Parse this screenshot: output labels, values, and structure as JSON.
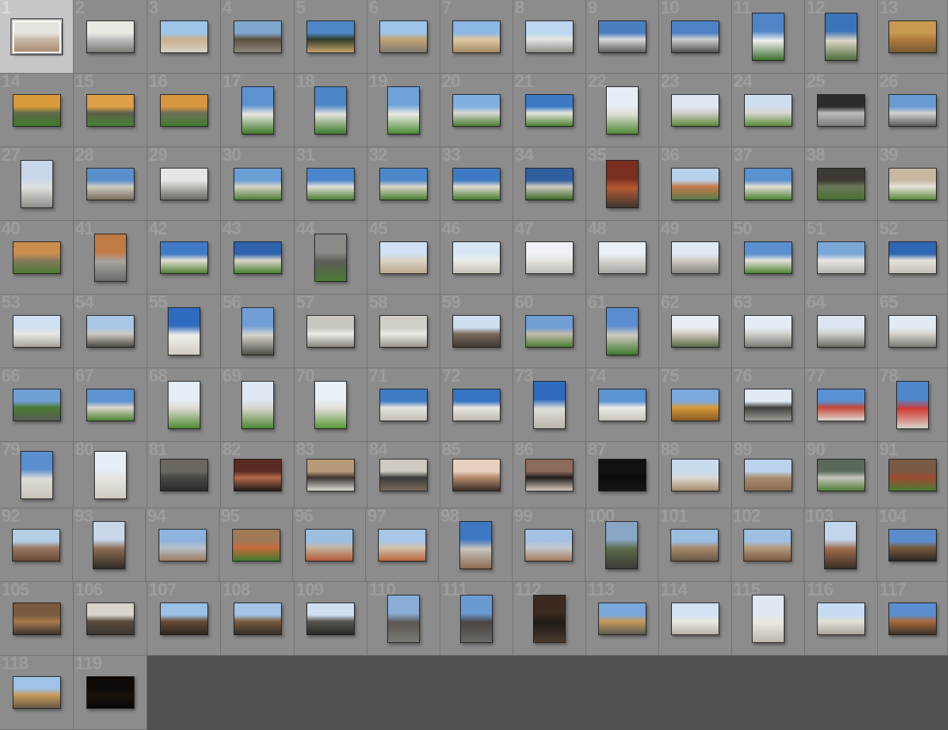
{
  "grid": {
    "columns": 13,
    "selected": 1,
    "tiles": [
      {
        "n": "1",
        "o": "land",
        "c": [
          "#e8e4df",
          "#c9b9a6",
          "#a98d75"
        ]
      },
      {
        "n": "2",
        "o": "land",
        "c": [
          "#eae9e4",
          "#bfbfbf",
          "#7a7a76"
        ]
      },
      {
        "n": "3",
        "o": "land",
        "c": [
          "#9ec4e8",
          "#c9b08a",
          "#d8d2c8"
        ]
      },
      {
        "n": "4",
        "o": "land",
        "c": [
          "#7fa8cf",
          "#5b4f3c",
          "#8e8a80"
        ]
      },
      {
        "n": "5",
        "o": "land",
        "c": [
          "#4f86c6",
          "#2f3d2a",
          "#c9a46a"
        ]
      },
      {
        "n": "6",
        "o": "land",
        "c": [
          "#9ec6ea",
          "#c4a271",
          "#7f7a72"
        ]
      },
      {
        "n": "7",
        "o": "land",
        "c": [
          "#8cb8e5",
          "#e2c9a0",
          "#a28a66"
        ]
      },
      {
        "n": "8",
        "o": "land",
        "c": [
          "#bcd7ef",
          "#e7e5e1",
          "#8f8e8a"
        ]
      },
      {
        "n": "9",
        "o": "land",
        "c": [
          "#4b7fbf",
          "#dcdcdc",
          "#5b5b58"
        ]
      },
      {
        "n": "10",
        "o": "land",
        "c": [
          "#4d82c4",
          "#d0d0cf",
          "#4f4f4d"
        ]
      },
      {
        "n": "11",
        "o": "port",
        "c": [
          "#4f86c7",
          "#eeeeee",
          "#3e6f2e"
        ]
      },
      {
        "n": "12",
        "o": "port",
        "c": [
          "#3d73b8",
          "#ddd7c8",
          "#4d6b3a"
        ]
      },
      {
        "n": "13",
        "o": "land",
        "c": [
          "#c89a52",
          "#b07a3c",
          "#7a5a34"
        ]
      },
      {
        "n": "14",
        "o": "land",
        "c": [
          "#d99b3a",
          "#5f6a4a",
          "#3f7a2a"
        ]
      },
      {
        "n": "15",
        "o": "land",
        "c": [
          "#e0a048",
          "#5a5f48",
          "#468034"
        ]
      },
      {
        "n": "16",
        "o": "land",
        "c": [
          "#d6973e",
          "#6f6f5a",
          "#3f7d2c"
        ]
      },
      {
        "n": "17",
        "o": "port",
        "c": [
          "#5c92cf",
          "#e8e6e1",
          "#3f7a2a"
        ]
      },
      {
        "n": "18",
        "o": "port",
        "c": [
          "#4b85c8",
          "#e4e2dc",
          "#3d7a2b"
        ]
      },
      {
        "n": "19",
        "o": "port",
        "c": [
          "#6ea2d8",
          "#eceae4",
          "#4a8a32"
        ]
      },
      {
        "n": "20",
        "o": "land",
        "c": [
          "#7fb0e0",
          "#d8d8d4",
          "#4b7f33"
        ]
      },
      {
        "n": "21",
        "o": "land",
        "c": [
          "#3e7ac4",
          "#e6e4de",
          "#4c8233"
        ]
      },
      {
        "n": "22",
        "o": "port",
        "c": [
          "#e8eef6",
          "#e0ddd5",
          "#4e8a34"
        ]
      },
      {
        "n": "23",
        "o": "land",
        "c": [
          "#dfe8f2",
          "#cfcdc8",
          "#5a8a3a"
        ]
      },
      {
        "n": "24",
        "o": "land",
        "c": [
          "#cfdff0",
          "#d8d6d0",
          "#5b8c3c"
        ]
      },
      {
        "n": "25",
        "o": "land",
        "c": [
          "#2c2c2c",
          "#bcbcb8",
          "#7c7c78"
        ]
      },
      {
        "n": "26",
        "o": "land",
        "c": [
          "#6a9bd3",
          "#d2d2cf",
          "#5c5c59"
        ]
      },
      {
        "n": "27",
        "o": "port",
        "c": [
          "#c8d8ea",
          "#dfdfdc",
          "#8c8c88"
        ]
      },
      {
        "n": "28",
        "o": "land",
        "c": [
          "#5a8fcc",
          "#cfccc4",
          "#7a6e5c"
        ]
      },
      {
        "n": "29",
        "o": "land",
        "c": [
          "#e6e6e4",
          "#bdbdb8",
          "#6c6c66"
        ]
      },
      {
        "n": "30",
        "o": "land",
        "c": [
          "#6c9fd6",
          "#d8d4c8",
          "#4f7f37"
        ]
      },
      {
        "n": "31",
        "o": "land",
        "c": [
          "#4a86cb",
          "#e2e0da",
          "#4c7f33"
        ]
      },
      {
        "n": "32",
        "o": "land",
        "c": [
          "#4e88cc",
          "#dcd7cb",
          "#4a7d30"
        ]
      },
      {
        "n": "33",
        "o": "land",
        "c": [
          "#3f7bc4",
          "#e0dbd0",
          "#497c31"
        ]
      },
      {
        "n": "34",
        "o": "land",
        "c": [
          "#2f5f9f",
          "#cfcac0",
          "#3c6a28"
        ]
      },
      {
        "n": "35",
        "o": "port",
        "c": [
          "#7a2f1e",
          "#b55a32",
          "#3d3530"
        ]
      },
      {
        "n": "36",
        "o": "land",
        "c": [
          "#b8d2ec",
          "#c77a4a",
          "#5a7a4a"
        ]
      },
      {
        "n": "37",
        "o": "land",
        "c": [
          "#5a91d0",
          "#e2ddd1",
          "#4d8236"
        ]
      },
      {
        "n": "38",
        "o": "land",
        "c": [
          "#3d3a33",
          "#6a7a5a",
          "#4a6f32"
        ]
      },
      {
        "n": "39",
        "o": "land",
        "c": [
          "#c8b8a2",
          "#e6e2da",
          "#5a8a3a"
        ]
      },
      {
        "n": "40",
        "o": "land",
        "c": [
          "#c98e4c",
          "#8a7a5e",
          "#4a7a30"
        ]
      },
      {
        "n": "41",
        "o": "port",
        "c": [
          "#c07a44",
          "#a8a4a0",
          "#6a6a66"
        ]
      },
      {
        "n": "42",
        "o": "land",
        "c": [
          "#3f7ac6",
          "#e4dfd4",
          "#4d8034"
        ]
      },
      {
        "n": "43",
        "o": "land",
        "c": [
          "#2f63ad",
          "#dcd6ca",
          "#497e32"
        ]
      },
      {
        "n": "44",
        "o": "port",
        "c": [
          "#8a8a86",
          "#5c5c58",
          "#4a7a33"
        ]
      },
      {
        "n": "45",
        "o": "land",
        "c": [
          "#cfe1f2",
          "#dcd4c4",
          "#b8a98e"
        ]
      },
      {
        "n": "46",
        "o": "land",
        "c": [
          "#d7e6f4",
          "#eeeeea",
          "#c7c2b8"
        ]
      },
      {
        "n": "47",
        "o": "land",
        "c": [
          "#eef2f6",
          "#e6e4e0",
          "#bdbbb6"
        ]
      },
      {
        "n": "48",
        "o": "land",
        "c": [
          "#eaf0f6",
          "#d8d6d2",
          "#a8a6a2"
        ]
      },
      {
        "n": "49",
        "o": "land",
        "c": [
          "#dfe9f4",
          "#cfcbc3",
          "#8a8782"
        ]
      },
      {
        "n": "50",
        "o": "land",
        "c": [
          "#5a90cf",
          "#e6e2da",
          "#4f8236"
        ]
      },
      {
        "n": "51",
        "o": "land",
        "c": [
          "#7aa7d8",
          "#e8e6e2",
          "#b5b2ac"
        ]
      },
      {
        "n": "52",
        "o": "land",
        "c": [
          "#2f67b4",
          "#e6e3dd",
          "#c2beb6"
        ]
      },
      {
        "n": "53",
        "o": "land",
        "c": [
          "#cfe0f2",
          "#e8e6e0",
          "#a8a49c"
        ]
      },
      {
        "n": "54",
        "o": "land",
        "c": [
          "#a8c6e6",
          "#cfcbc3",
          "#4b4944"
        ]
      },
      {
        "n": "55",
        "o": "port",
        "c": [
          "#2f6bbf",
          "#f0efec",
          "#d0ccc4"
        ]
      },
      {
        "n": "56",
        "o": "port",
        "c": [
          "#6f9fd6",
          "#d8d4cc",
          "#4f4d48"
        ]
      },
      {
        "n": "57",
        "o": "land",
        "c": [
          "#c9c6bf",
          "#eeece8",
          "#8a8782"
        ]
      },
      {
        "n": "58",
        "o": "land",
        "c": [
          "#d2cfc8",
          "#ebe9e4",
          "#9a968e"
        ]
      },
      {
        "n": "59",
        "o": "land",
        "c": [
          "#cfe0f2",
          "#7a6a5c",
          "#3f3a34"
        ]
      },
      {
        "n": "60",
        "o": "land",
        "c": [
          "#6f9fd4",
          "#c4bcae",
          "#4b7d32"
        ]
      },
      {
        "n": "61",
        "o": "port",
        "c": [
          "#5a8ed0",
          "#cfcac0",
          "#3e7a2c"
        ]
      },
      {
        "n": "62",
        "o": "land",
        "c": [
          "#e8eef4",
          "#cfc9bd",
          "#5a6a44"
        ]
      },
      {
        "n": "63",
        "o": "land",
        "c": [
          "#e6edf4",
          "#d0d0cc",
          "#7a7a76"
        ]
      },
      {
        "n": "64",
        "o": "land",
        "c": [
          "#dbe6f2",
          "#cfccc6",
          "#6c6c68"
        ]
      },
      {
        "n": "65",
        "o": "land",
        "c": [
          "#e2ebf4",
          "#d6d3cc",
          "#7c7a76"
        ]
      },
      {
        "n": "66",
        "o": "land",
        "c": [
          "#6fa0d6",
          "#4a7a32",
          "#5a5a56"
        ]
      },
      {
        "n": "67",
        "o": "land",
        "c": [
          "#5c92d0",
          "#dcd6ca",
          "#4d8234"
        ]
      },
      {
        "n": "68",
        "o": "port",
        "c": [
          "#e6eef6",
          "#dcd8cf",
          "#4f8a33"
        ]
      },
      {
        "n": "69",
        "o": "port",
        "c": [
          "#dde8f3",
          "#d6d2c9",
          "#4e8834"
        ]
      },
      {
        "n": "70",
        "o": "port",
        "c": [
          "#e9f0f6",
          "#e2ded6",
          "#5a9638"
        ]
      },
      {
        "n": "71",
        "o": "land",
        "c": [
          "#3f7cc6",
          "#e6e4de",
          "#c2beb6"
        ]
      },
      {
        "n": "72",
        "o": "land",
        "c": [
          "#3575c4",
          "#e8e6e0",
          "#bdb9b1"
        ]
      },
      {
        "n": "73",
        "o": "port",
        "c": [
          "#2f6cbd",
          "#e2e0da",
          "#b8b4ac"
        ]
      },
      {
        "n": "74",
        "o": "land",
        "c": [
          "#5a92d2",
          "#ecebe7",
          "#c8c4bc"
        ]
      },
      {
        "n": "75",
        "o": "land",
        "c": [
          "#7aaade",
          "#d69a3a",
          "#8a5a24"
        ]
      },
      {
        "n": "76",
        "o": "land",
        "c": [
          "#e2eaf4",
          "#3f3f3c",
          "#9a9a96"
        ]
      },
      {
        "n": "77",
        "o": "land",
        "c": [
          "#5a91d2",
          "#c8463a",
          "#dcd8d0"
        ]
      },
      {
        "n": "78",
        "o": "port",
        "c": [
          "#4d87cb",
          "#d43a32",
          "#d8d4cc"
        ]
      },
      {
        "n": "79",
        "o": "port",
        "c": [
          "#5a90d0",
          "#dedcd6",
          "#c8c4ba"
        ]
      },
      {
        "n": "80",
        "o": "port",
        "c": [
          "#e6eef6",
          "#e6e4de",
          "#cfcbc3"
        ]
      },
      {
        "n": "81",
        "o": "land",
        "c": [
          "#6a6660",
          "#4a4743",
          "#2c2a28"
        ]
      },
      {
        "n": "82",
        "o": "land",
        "c": [
          "#5a2a22",
          "#b56a4c",
          "#1e1a18"
        ]
      },
      {
        "n": "83",
        "o": "land",
        "c": [
          "#b89a7a",
          "#3a3430",
          "#dedcd8"
        ]
      },
      {
        "n": "84",
        "o": "land",
        "c": [
          "#cfcac2",
          "#3a3a3a",
          "#7a6a5c"
        ]
      },
      {
        "n": "85",
        "o": "land",
        "c": [
          "#e8d0c0",
          "#b58a6c",
          "#3a2e28"
        ]
      },
      {
        "n": "86",
        "o": "land",
        "c": [
          "#8a6a5a",
          "#1e1c1a",
          "#d8cabc"
        ]
      },
      {
        "n": "87",
        "o": "land",
        "c": [
          "#111111",
          "#0b0b0b",
          "#151515"
        ]
      },
      {
        "n": "88",
        "o": "land",
        "c": [
          "#c8dcef",
          "#dcdad4",
          "#a88a6a"
        ]
      },
      {
        "n": "89",
        "o": "land",
        "c": [
          "#bcd3ec",
          "#a88c70",
          "#8a6a4e"
        ]
      },
      {
        "n": "90",
        "o": "land",
        "c": [
          "#5a6a5a",
          "#c8c4bc",
          "#4f7f37"
        ]
      },
      {
        "n": "91",
        "o": "land",
        "c": [
          "#7a5a44",
          "#a04a32",
          "#4a7a32"
        ]
      },
      {
        "n": "92",
        "o": "land",
        "c": [
          "#b6cde6",
          "#9a7a62",
          "#6a4a38"
        ]
      },
      {
        "n": "93",
        "o": "port",
        "c": [
          "#c8d8ea",
          "#8a6a52",
          "#2e2a26"
        ]
      },
      {
        "n": "94",
        "o": "land",
        "c": [
          "#8eb4de",
          "#b6c2cc",
          "#9a7a5e"
        ]
      },
      {
        "n": "95",
        "o": "land",
        "c": [
          "#a07a56",
          "#c86a3a",
          "#3f7a2e"
        ]
      },
      {
        "n": "96",
        "o": "land",
        "c": [
          "#9ebfe2",
          "#c4b4a0",
          "#b05a36"
        ]
      },
      {
        "n": "97",
        "o": "land",
        "c": [
          "#a8c6e6",
          "#d2c4ae",
          "#b8683e"
        ]
      },
      {
        "n": "98",
        "o": "port",
        "c": [
          "#3f78c2",
          "#c8c4bc",
          "#8a6a52"
        ]
      },
      {
        "n": "99",
        "o": "land",
        "c": [
          "#a4c2e4",
          "#c6cad0",
          "#a47a5a"
        ]
      },
      {
        "n": "100",
        "o": "port",
        "c": [
          "#8aa6c6",
          "#5a6a4a",
          "#3a3a36"
        ]
      },
      {
        "n": "101",
        "o": "land",
        "c": [
          "#9abde2",
          "#a88a6a",
          "#6a5a4a"
        ]
      },
      {
        "n": "102",
        "o": "land",
        "c": [
          "#a0c0e2",
          "#b89a7e",
          "#7a5a44"
        ]
      },
      {
        "n": "103",
        "o": "port",
        "c": [
          "#c2d6ec",
          "#9a6a4a",
          "#3a2e26"
        ]
      },
      {
        "n": "104",
        "o": "land",
        "c": [
          "#5a8ccc",
          "#7a5a3c",
          "#2a2724"
        ]
      },
      {
        "n": "105",
        "o": "land",
        "c": [
          "#7a5a3e",
          "#a87a4c",
          "#3a342e"
        ]
      },
      {
        "n": "106",
        "o": "land",
        "c": [
          "#d8d4cc",
          "#5a4a3c",
          "#3a3632"
        ]
      },
      {
        "n": "107",
        "o": "land",
        "c": [
          "#9ac0e6",
          "#6a4a32",
          "#2a2622"
        ]
      },
      {
        "n": "108",
        "o": "land",
        "c": [
          "#a4c4e6",
          "#7a5a3c",
          "#34302c"
        ]
      },
      {
        "n": "109",
        "o": "land",
        "c": [
          "#cfe0f2",
          "#5a5550",
          "#2c2a28"
        ]
      },
      {
        "n": "110",
        "o": "port",
        "c": [
          "#8aaed6",
          "#5c5650",
          "#7a7a76"
        ]
      },
      {
        "n": "111",
        "o": "port",
        "c": [
          "#6a9ad2",
          "#4a4440",
          "#6a6a66"
        ]
      },
      {
        "n": "112",
        "o": "port",
        "c": [
          "#3a2a20",
          "#1e1a16",
          "#4a3a2e"
        ]
      },
      {
        "n": "113",
        "o": "land",
        "c": [
          "#7aa8da",
          "#c89a5a",
          "#5a5a56"
        ]
      },
      {
        "n": "114",
        "o": "land",
        "c": [
          "#d0e2f4",
          "#ece8de",
          "#b6b2aa"
        ]
      },
      {
        "n": "115",
        "o": "port",
        "c": [
          "#dfe9f4",
          "#ebe8e0",
          "#bcb8b0"
        ]
      },
      {
        "n": "116",
        "o": "land",
        "c": [
          "#c6dcf2",
          "#e4e0d6",
          "#a8a49c"
        ]
      },
      {
        "n": "117",
        "o": "land",
        "c": [
          "#5a8ed0",
          "#a86a3a",
          "#3a342e"
        ]
      },
      {
        "n": "118",
        "o": "land",
        "c": [
          "#9ec2e8",
          "#c89a5a",
          "#6a5a4a"
        ]
      },
      {
        "n": "119",
        "o": "land",
        "c": [
          "#0e0a08",
          "#1a120c",
          "#08070a"
        ]
      }
    ]
  }
}
